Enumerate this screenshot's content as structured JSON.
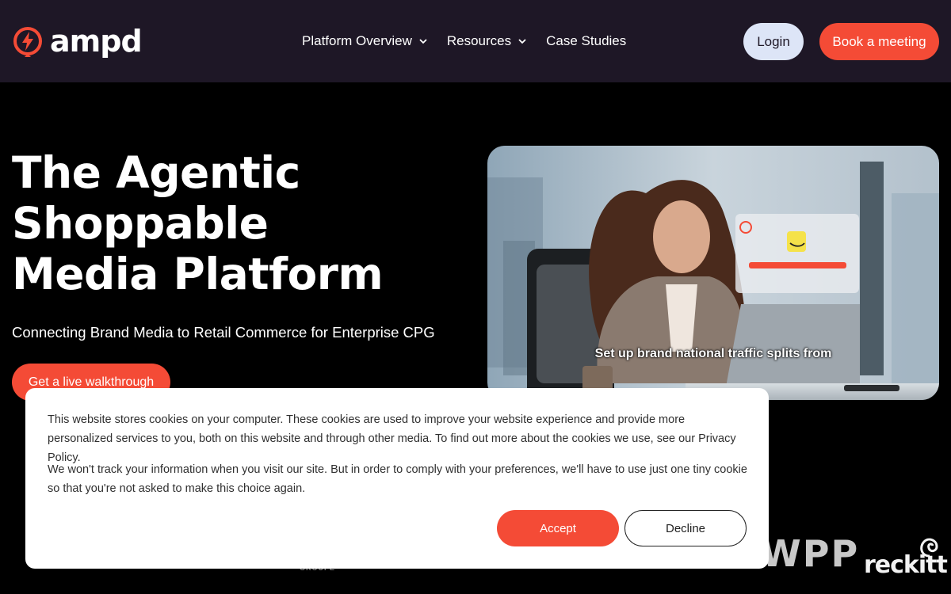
{
  "brand": {
    "name": "ampd",
    "icon": "lightning-bolt-circle-icon",
    "accent": "#f44b36"
  },
  "nav": {
    "items": [
      {
        "label": "Platform Overview",
        "has_dropdown": true
      },
      {
        "label": "Resources",
        "has_dropdown": true
      },
      {
        "label": "Case Studies",
        "has_dropdown": false
      }
    ],
    "login_label": "Login",
    "book_label": "Book a meeting"
  },
  "hero": {
    "title": "The Agentic Shoppable Media Platform",
    "subtitle": "Connecting Brand Media to Retail Commerce for Enterprise CPG",
    "cta_label": "Get a live walkthrough",
    "video_caption": "Set up brand national traffic splits from"
  },
  "logos": {
    "groupe": "GROUPE",
    "wpp": "WPP",
    "reckitt": "reckitt"
  },
  "cookie": {
    "text1": "This website stores cookies on your computer. These cookies are used to improve your website experience and provide more personalized services to you, both on this website and through other media. To find out more about the cookies we use, see our Privacy Policy.",
    "text2": "We won't track your information when you visit our site. But in order to comply with your preferences, we'll have to use just one tiny cookie so that you're not asked to make this choice again.",
    "accept_label": "Accept",
    "decline_label": "Decline"
  }
}
